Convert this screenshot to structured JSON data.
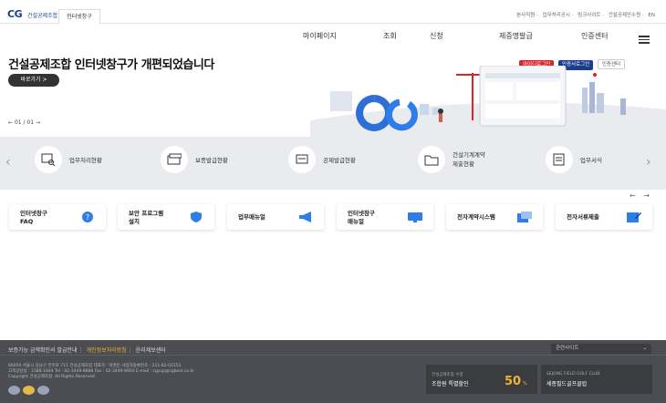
{
  "header": {
    "logo_mark": "CG",
    "logo_text": "건설공제조합",
    "site_tab": "인터넷창구",
    "util_links": [
      "본사직원",
      "업무처리공시",
      "링크사이트",
      "건설공제안수원",
      "EN"
    ]
  },
  "nav": {
    "items": [
      "마이페이지",
      "조회",
      "신청",
      "제증명발급",
      "인증센터"
    ]
  },
  "hero": {
    "title": "건설공제조합 인터넷창구가 개편되었습니다",
    "cta_label": "바로가기 >",
    "pager": "01 / 01",
    "login_buttons": [
      "아이디로그인",
      "인증서로그인",
      "인증센터"
    ]
  },
  "quick_services": [
    {
      "label": "업무처리현황",
      "icon": "document-search-icon"
    },
    {
      "label": "보증발급현황",
      "icon": "card-icon"
    },
    {
      "label": "공제발급현황",
      "icon": "stack-icon"
    },
    {
      "label": "건설기계계약\n제출현황",
      "icon": "folder-icon"
    },
    {
      "label": "업무서식",
      "icon": "form-icon"
    }
  ],
  "cards": [
    {
      "label": "인터넷창구\nFAQ",
      "icon": "question-icon"
    },
    {
      "label": "보안 프로그램\n설치",
      "icon": "shield-icon"
    },
    {
      "label": "업무매뉴얼",
      "icon": "megaphone-icon"
    },
    {
      "label": "인터넷창구\n매뉴얼",
      "icon": "monitor-icon"
    },
    {
      "label": "전자계약시스템",
      "icon": "contract-icon"
    },
    {
      "label": "전자서류제출",
      "icon": "edit-icon"
    }
  ],
  "footer": {
    "links": [
      "보증가능 금액확인서 발급안내",
      "개인정보처리방침",
      "윤리제보센터"
    ],
    "related_sites": "관련사이트",
    "address_lines": [
      "06050 서울시 강남구 언주로 711 건설공제조합  대표자 : 박영빈  사업자등록번호 : 211-82-02251",
      "고객상담실 : 1588-1844  Tel : 02-3449-8888  Fax : 02-3449-8903  E-mail : cgsup@cgbest.co.kr",
      "Copyright 건설공제조합. All Rights Reserved."
    ],
    "banner1": {
      "small": "건설공제조합 수령",
      "big": "조합원 특별할인",
      "pct": "50",
      "unit": "%"
    },
    "banner2": {
      "small": "SEJONG FIELD GOLF CLUB",
      "big": "세종필드골프클럽"
    }
  },
  "colors": {
    "brand_blue": "#1a3d8f",
    "brand_red": "#d8262e",
    "accent_yellow": "#f2b233",
    "footer_bg": "#4b4d52",
    "band_bg": "#e9ebef"
  }
}
